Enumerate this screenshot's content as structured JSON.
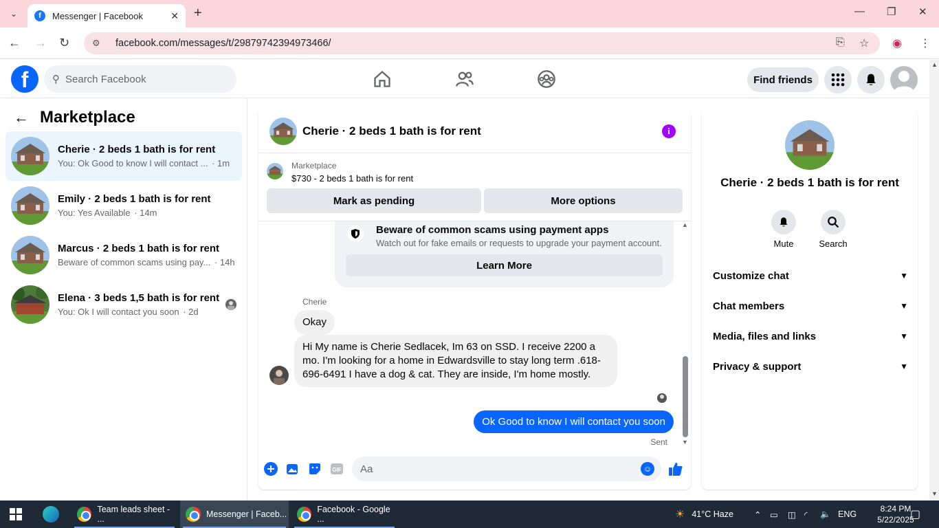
{
  "browser": {
    "tab_title": "Messenger | Facebook",
    "url": "facebook.com/messages/t/29879742394973466/"
  },
  "fb_header": {
    "search_placeholder": "Search Facebook",
    "find_friends": "Find friends"
  },
  "marketplace": {
    "title": "Marketplace",
    "conversations": [
      {
        "name": "Cherie · 2 beds 1 bath is for rent",
        "preview": "You: Ok Good to know I will contact ...",
        "time": "· 1m",
        "active": true
      },
      {
        "name": "Emily · 2 beds 1 bath is for rent",
        "preview": "You: Yes Available",
        "time": "· 14m"
      },
      {
        "name": "Marcus · 2 beds 1 bath is for rent",
        "preview": "Beware of common scams using pay...",
        "time": "· 14h"
      },
      {
        "name": "Elena · 3 beds 1,5 bath is for rent",
        "preview": "You: Ok I will contact you soon",
        "time": "· 2d"
      }
    ]
  },
  "chat": {
    "title": "Cherie · 2 beds 1 bath is for rent",
    "listing_source": "Marketplace",
    "listing_title": "$730 - 2 beds 1 bath is for rent",
    "mark_pending": "Mark as pending",
    "more_options": "More options",
    "scam_title": "Beware of common scams using payment apps",
    "scam_body": "Watch out for fake emails or requests to upgrade your payment account.",
    "learn_more": "Learn More",
    "sender": "Cherie",
    "msg1": "Okay",
    "msg2": "Hi My name is Cherie Sedlacek, Im 63 on SSD. I receive 2200 a mo. I'm looking for a home in Edwardsville to stay long term .618-696-6491 I have a dog & cat. They are inside, I'm home mostly.",
    "msg_out": "Ok Good to know I will contact you soon",
    "sent_label": "Sent",
    "composer_placeholder": "Aa"
  },
  "right_panel": {
    "name": "Cherie · 2 beds 1 bath is for rent",
    "mute": "Mute",
    "search": "Search",
    "sections": [
      "Customize chat",
      "Chat members",
      "Media, files and links",
      "Privacy & support"
    ]
  },
  "taskbar": {
    "items": [
      "Team leads sheet - ...",
      "Messenger | Faceb...",
      "Facebook - Google ..."
    ],
    "weather": "41°C  Haze",
    "lang": "ENG",
    "time": "8:24 PM",
    "date": "5/22/2025"
  },
  "colors": {
    "fb_blue": "#0866ff",
    "active_conv_bg": "#ebf5ff",
    "info_purple": "#a100ff",
    "tab_strip": "#fbd6dc"
  }
}
